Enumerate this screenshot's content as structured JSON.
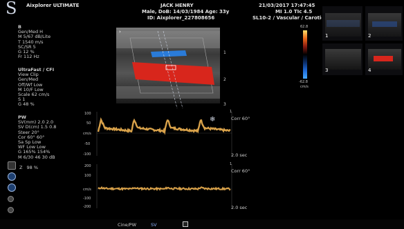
{
  "header": {
    "brand": "Aixplorer ULTIMATE",
    "patient_name": "JACK HENRY",
    "patient_info": "Male, DoB: 14/03/1984 Age: 33y",
    "patient_id": "ID: Aixplorer_227808656",
    "datetime": "21/03/2017 17:47:45",
    "mi_tic": "MI 1.0  TIc  4.5",
    "probe_preset": "SL10-2 / Vascular / Carotid"
  },
  "bmode_params": {
    "title": "B",
    "lines": [
      "Gen/Med H",
      "M 5/67 dB/Lite",
      "T 1540 m/s",
      "SC/SR 5",
      "G 12 %",
      "Fr 112 Hz"
    ]
  },
  "cfi_params": {
    "title": "UltraFast / CFI",
    "lines": [
      "View Clip",
      "Gen/Med",
      "Off/Wf Low",
      "M 10/F Low",
      "Scale 62 cm/s",
      "S 1",
      "G 48 %"
    ]
  },
  "pw_params": {
    "title": "PW",
    "lines": [
      "SV(mm) 2.0 2.0",
      "SV D(cm) 1.5 0.8",
      "Steer 20°",
      "Cor 60° 60°",
      "Sa Sp Low",
      "WF Low Low",
      "G 165% 154%",
      "M 6/30 46 30 dB"
    ]
  },
  "zoom": {
    "label": "Z",
    "value": "98 %"
  },
  "colorbar": {
    "top": "62.8",
    "bottom": "-62.8",
    "unit": "cm/s"
  },
  "image_depth_ticks": [
    "1",
    "2",
    "3"
  ],
  "doppler1": {
    "corr_label": "Corr 60°",
    "scale_label": "2.0 sec",
    "y_ticks": [
      "100",
      "50",
      "cm/s",
      "-50",
      "-100"
    ],
    "marker_1": "1"
  },
  "doppler2": {
    "corr_label": "Corr 60°",
    "scale_label": "2.0 sec",
    "y_ticks": [
      "200",
      "100",
      "cm/s",
      "-100",
      "-200"
    ],
    "marker_1": "1"
  },
  "thumbnails": [
    {
      "num": "1"
    },
    {
      "num": "2"
    },
    {
      "num": "3"
    },
    {
      "num": "4"
    }
  ],
  "bottom_bar": {
    "mode_label": "Cine/PW",
    "sv_label": "SV"
  },
  "colors": {
    "flow_red": "#d8261c",
    "flow_blue": "#2a7bd8",
    "doppler_trace": "#d9a24a",
    "colorbar_top": "#ffe06a",
    "colorbar_bottom": "#46a8ff"
  },
  "icons": [
    "supersonic-logo-icon",
    "settings-icon",
    "close-icon",
    "power-icon",
    "nav-arrow-icon",
    "snowflake-freeze-icon",
    "probe-icon",
    "cursor-icon"
  ]
}
